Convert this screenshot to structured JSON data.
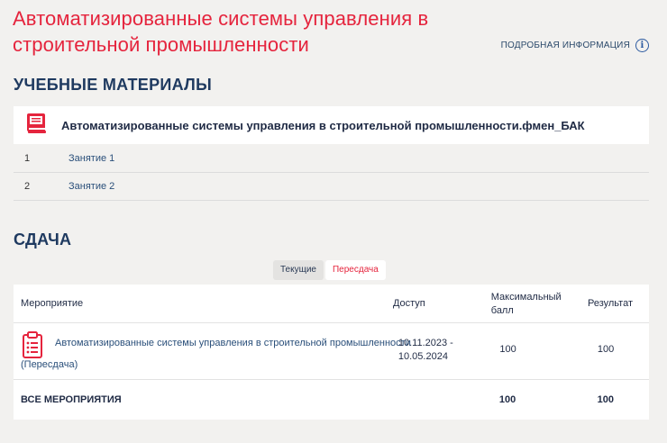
{
  "header": {
    "title": "Автоматизированные системы управления в строительной промышленности",
    "more_info": "ПОДРОБНАЯ ИНФОРМАЦИЯ"
  },
  "materials": {
    "section_title": "УЧЕБНЫЕ МАТЕРИАЛЫ",
    "card_name": "Автоматизированные системы управления в строительной промышленности.фмен_БАК",
    "lessons": [
      {
        "num": "1",
        "label": "Занятие 1"
      },
      {
        "num": "2",
        "label": "Занятие 2"
      }
    ]
  },
  "submission": {
    "section_title": "СДАЧА",
    "tabs": {
      "current": "Текущие",
      "retake": "Пересдача"
    },
    "columns": {
      "event": "Мероприятие",
      "access": "Доступ",
      "max": "Максимальный балл",
      "result": "Результат"
    },
    "row": {
      "event": "Автоматизированные системы управления в строительной промышленности",
      "event_suffix": "(Пересдача)",
      "access": "10.11.2023 - 10.05.2024",
      "max": "100",
      "result": "100"
    },
    "total": {
      "label": "ВСЕ МЕРОПРИЯТИЯ",
      "max": "100",
      "result": "100"
    }
  },
  "colors": {
    "accent": "#e5243d",
    "heading": "#1f3a60",
    "link": "#2a4f7a"
  },
  "icons": {
    "info": "info-icon",
    "book": "book-icon",
    "clipboard": "clipboard-icon"
  }
}
